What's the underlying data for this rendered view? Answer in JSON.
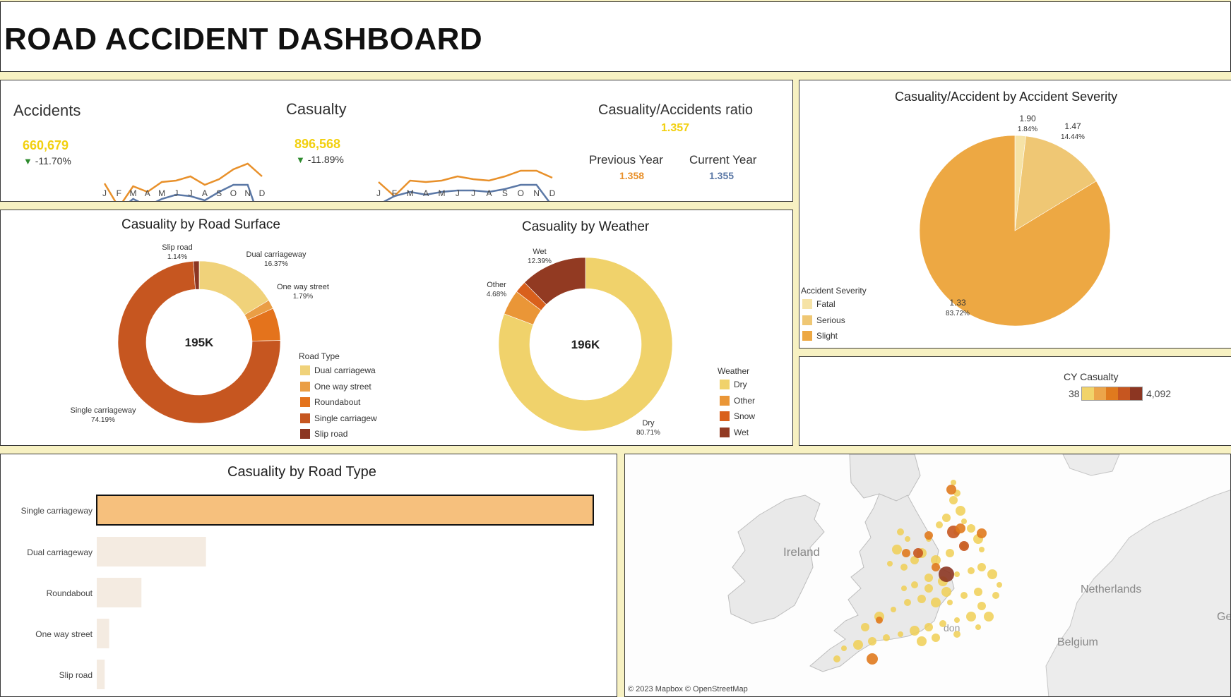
{
  "title": "ROAD ACCIDENT DASHBOARD",
  "kpis": {
    "accidents": {
      "label": "Accidents",
      "value": "660,679",
      "change": "-11.70%",
      "color": "#f2d00f"
    },
    "casualty": {
      "label": "Casualty",
      "value": "896,568",
      "change": "-11.89%",
      "color": "#f2d00f"
    },
    "ratio": {
      "label": "Casuality/Accidents ratio",
      "value": "1.357",
      "prev_label": "Previous Year",
      "prev_value": "1.358",
      "curr_label": "Current Year",
      "curr_value": "1.355"
    }
  },
  "months": [
    "J",
    "F",
    "M",
    "A",
    "M",
    "J",
    "J",
    "A",
    "S",
    "O",
    "N",
    "D"
  ],
  "colors": {
    "previous": "#e8902a",
    "current": "#5b78a6",
    "kpi_value": "#f2d00f"
  },
  "chart_data": [
    {
      "type": "line",
      "name": "accidents_trend",
      "x": [
        "J",
        "F",
        "M",
        "A",
        "M",
        "J",
        "J",
        "A",
        "S",
        "O",
        "N",
        "D"
      ],
      "series": [
        {
          "values": [
            72,
            55,
            70,
            66,
            73,
            74,
            77,
            71,
            75,
            82,
            86,
            77
          ]
        },
        {
          "values": [
            45,
            53,
            61,
            56,
            61,
            64,
            63,
            60,
            66,
            71,
            71,
            42
          ]
        }
      ]
    },
    {
      "type": "line",
      "name": "casualty_trend",
      "x": [
        "J",
        "F",
        "M",
        "A",
        "M",
        "J",
        "J",
        "A",
        "S",
        "O",
        "N",
        "D"
      ],
      "series": [
        {
          "values": [
            73,
            63,
            74,
            73,
            74,
            77,
            75,
            74,
            77,
            81,
            81,
            76
          ]
        },
        {
          "values": [
            57,
            63,
            66,
            64,
            66,
            67,
            67,
            66,
            68,
            71,
            71,
            56
          ]
        }
      ]
    },
    {
      "type": "pie",
      "name": "casualty_by_road_surface",
      "donut": true,
      "title": "Casuality by Road Surface",
      "center_label": "195K",
      "legend_title": "Road Type",
      "legend": [
        "Dual carriagewa",
        "One way street",
        "Roundabout",
        "Single carriagew",
        "Slip road"
      ],
      "slices": [
        {
          "label": "Dual carriageway",
          "pct": "16.37%",
          "value": 16.37,
          "color": "#f0d27a"
        },
        {
          "label": "One way street",
          "pct": "1.79%",
          "value": 1.79,
          "color": "#ea9e45"
        },
        {
          "label": "",
          "pct": "",
          "value": 6.51,
          "color": "#e4731c"
        },
        {
          "label": "Single carriageway",
          "pct": "74.19%",
          "value": 74.19,
          "color": "#c65620"
        },
        {
          "label": "Slip road",
          "pct": "1.14%",
          "value": 1.14,
          "color": "#8c3622"
        }
      ]
    },
    {
      "type": "pie",
      "name": "casualty_by_weather",
      "donut": true,
      "title": "Casuality by Weather",
      "center_label": "196K",
      "legend_title": "Weather",
      "legend": [
        "Dry",
        "Other",
        "Snow",
        "Wet"
      ],
      "slices": [
        {
          "label": "Dry",
          "pct": "80.71%",
          "value": 80.71,
          "color": "#f0d26b"
        },
        {
          "label": "Other",
          "pct": "4.68%",
          "value": 4.68,
          "color": "#ea9637"
        },
        {
          "label": "",
          "pct": "",
          "value": 2.22,
          "color": "#d9601c"
        },
        {
          "label": "Wet",
          "pct": "12.39%",
          "value": 12.39,
          "color": "#923a22"
        }
      ]
    },
    {
      "type": "pie",
      "name": "casualty_per_accident_by_severity",
      "title": "Casuality/Accident by Accident Severity",
      "legend_title": "Accident Severity",
      "legend": [
        "Fatal",
        "Serious",
        "Slight"
      ],
      "slices": [
        {
          "label": "Fatal",
          "ratio": "1.90",
          "pct": "1.84%",
          "value": 1.84,
          "color": "#f6e3a6"
        },
        {
          "label": "Serious",
          "ratio": "1.47",
          "pct": "14.44%",
          "value": 14.44,
          "color": "#efc774"
        },
        {
          "label": "Slight",
          "ratio": "1.33",
          "pct": "83.72%",
          "value": 83.72,
          "color": "#eda843"
        }
      ]
    },
    {
      "type": "bar",
      "name": "casualty_by_road_type",
      "orientation": "horizontal",
      "title": "Casuality by Road Type",
      "categories": [
        "Single carriageway",
        "Dual carriageway",
        "Roundabout",
        "One way street",
        "Slip road"
      ],
      "values": [
        100,
        22,
        9,
        2.5,
        1.6
      ]
    }
  ],
  "cy_casualty": {
    "label": "CY Casualty",
    "min": "38",
    "max": "4,092",
    "colors": [
      "#f1d36a",
      "#eca54a",
      "#e07a1e",
      "#c65620",
      "#8c3622"
    ]
  },
  "map": {
    "labels": [
      "Ireland",
      "Netherlands",
      "Belgium",
      "Ger",
      "don"
    ],
    "attribution": "© 2023 Mapbox  © OpenStreetMap"
  }
}
